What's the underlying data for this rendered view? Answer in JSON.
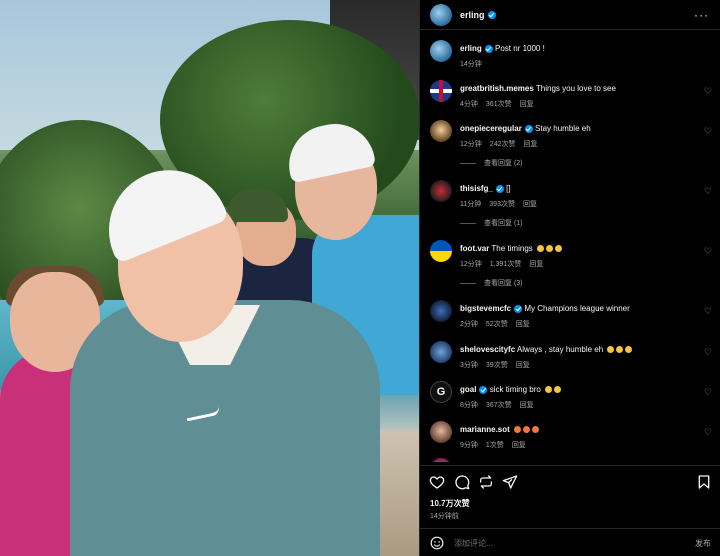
{
  "header": {
    "username": "erling",
    "more_label": "···"
  },
  "caption": {
    "username": "erling",
    "text": "Post nr 1000 !",
    "time": "14分钟"
  },
  "comments": [
    {
      "username": "greatbritish.memes",
      "verified": false,
      "text": "Things you love to see",
      "time": "4分钟",
      "likes": "361次赞",
      "reply": "回复"
    },
    {
      "username": "onepieceregular",
      "verified": true,
      "text": "Stay humble eh",
      "time": "12分钟",
      "likes": "242次赞",
      "reply": "回复",
      "view_replies": "查看回复 (2)"
    },
    {
      "username": "thisisfg_",
      "verified": true,
      "text": "[]",
      "time": "11分钟",
      "likes": "393次赞",
      "reply": "回复",
      "view_replies": "查看回复 (1)"
    },
    {
      "username": "foot.var",
      "verified": false,
      "text": "The timings",
      "time": "12分钟",
      "likes": "1,391次赞",
      "reply": "回复",
      "view_replies": "查看回复 (3)"
    },
    {
      "username": "bigstevemcfc",
      "verified": true,
      "text": "My Champions league winner",
      "time": "2分钟",
      "likes": "52次赞",
      "reply": "回复"
    },
    {
      "username": "shelovescityfc",
      "verified": false,
      "text": "Always , stay humble eh",
      "time": "3分钟",
      "likes": "39次赞",
      "reply": "回复"
    },
    {
      "username": "goal",
      "verified": true,
      "text": "sick timing bro",
      "time": "8分钟",
      "likes": "367次赞",
      "reply": "回复"
    },
    {
      "username": "marianne.sot",
      "verified": false,
      "text": "",
      "time": "9分钟",
      "likes": "1次赞",
      "reply": "回复"
    }
  ],
  "actions": {
    "like_count": "10.7万次赞",
    "post_time": "14分钟前"
  },
  "add_comment": {
    "placeholder": "添加评论...",
    "post_label": "发布"
  },
  "colors": {
    "background": "#000000",
    "verified": "#0095f6",
    "muted": "#a8a8a8"
  }
}
